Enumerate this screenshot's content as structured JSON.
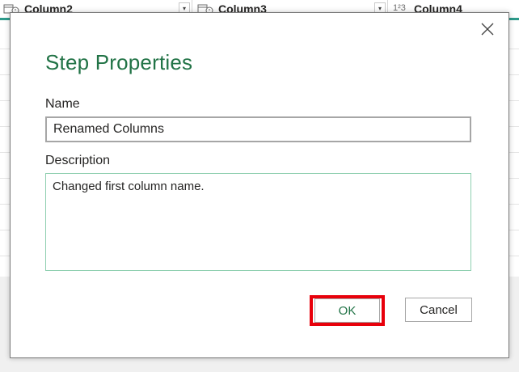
{
  "background": {
    "columns": [
      {
        "label": "Column2",
        "type_icon": "calendar-clock-icon"
      },
      {
        "label": "Column3",
        "type_icon": "calendar-clock-icon"
      },
      {
        "label": "Column4",
        "type_icon": "abc-123-icon"
      }
    ]
  },
  "dialog": {
    "title": "Step Properties",
    "name_label": "Name",
    "name_value": "Renamed Columns",
    "description_label": "Description",
    "description_value": "Changed first column name.",
    "ok_label": "OK",
    "cancel_label": "Cancel",
    "close_icon": "close-icon"
  },
  "colors": {
    "accent": "#217346",
    "highlight": "#e8000b",
    "column_accent": "#2d9a8a"
  }
}
